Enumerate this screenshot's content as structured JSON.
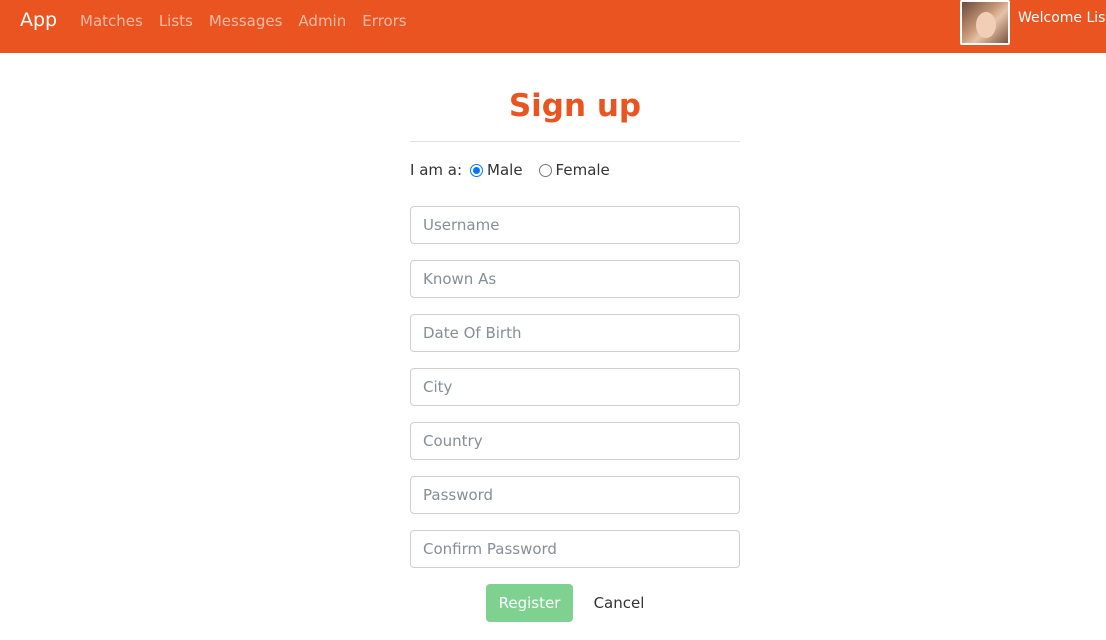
{
  "navbar": {
    "brand": "App",
    "links": [
      "Matches",
      "Lists",
      "Messages",
      "Admin",
      "Errors"
    ],
    "welcome": "Welcome Lis",
    "color": "#e95420"
  },
  "form": {
    "title": "Sign up",
    "gender_label": "I am a:",
    "gender_options": [
      "Male",
      "Female"
    ],
    "gender_selected": "Male",
    "fields": {
      "username": "Username",
      "known_as": "Known As",
      "dob": "Date Of Birth",
      "city": "City",
      "country": "Country",
      "password": "Password",
      "confirm_password": "Confirm Password"
    },
    "register_label": "Register",
    "cancel_label": "Cancel",
    "register_color": "#7ed18e"
  }
}
